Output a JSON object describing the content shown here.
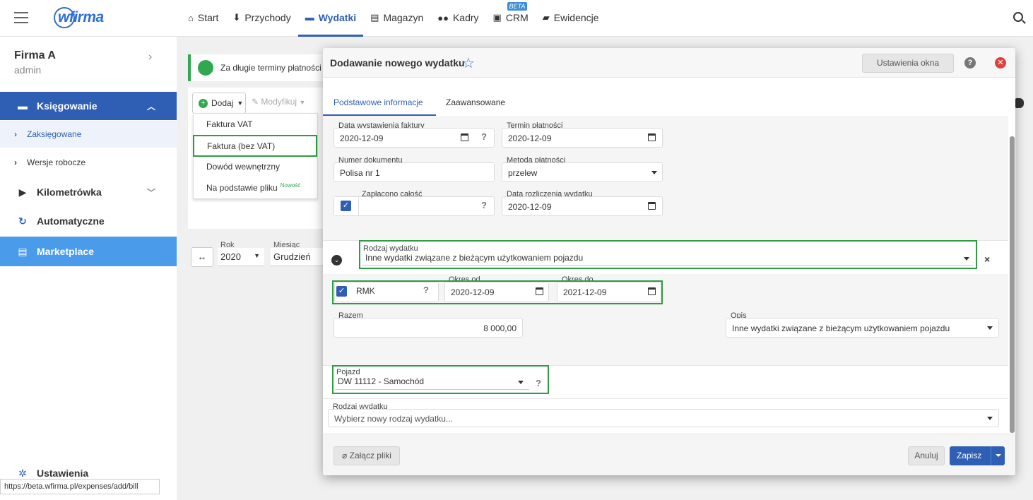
{
  "topnav": {
    "items": [
      {
        "label": "Start",
        "icon": "home-icon"
      },
      {
        "label": "Przychody",
        "icon": "income-icon"
      },
      {
        "label": "Wydatki",
        "icon": "wallet-icon"
      },
      {
        "label": "Magazyn",
        "icon": "warehouse-icon"
      },
      {
        "label": "Kadry",
        "icon": "people-icon"
      },
      {
        "label": "CRM",
        "icon": "crm-icon",
        "badge": "BETA"
      },
      {
        "label": "Ewidencje",
        "icon": "folder-icon"
      }
    ],
    "active": "Wydatki",
    "logo": "wfirma"
  },
  "sidebar": {
    "company_name": "Firma A",
    "user": "admin",
    "items": [
      {
        "label": "Księgowanie"
      },
      {
        "label": "Zaksięgowane"
      },
      {
        "label": "Wersje robocze"
      },
      {
        "label": "Kilometrówka"
      },
      {
        "label": "Automatyczne"
      },
      {
        "label": "Marketplace"
      },
      {
        "label": "Ustawienia"
      }
    ]
  },
  "statusbar": {
    "url": "https://beta.wfirma.pl/expenses/add/bill"
  },
  "background": {
    "banner_text": "Za długie terminy płatności",
    "dodaj_label": "Dodaj",
    "modyfikuj_label": "Modyfikuj",
    "dropdown_items": [
      {
        "label": "Faktura VAT"
      },
      {
        "label": "Faktura (bez VAT)"
      },
      {
        "label": "Dowód wewnętrzny"
      },
      {
        "label": "Na podstawie pliku",
        "badge": "Nowość"
      }
    ],
    "rok_label": "Rok",
    "rok_value": "2020",
    "miesiac_label": "Miesiąc",
    "miesiac_value": "Grudzień"
  },
  "modal": {
    "title": "Dodawanie nowego wydatku",
    "settings_button": "Ustawienia okna",
    "tabs": [
      {
        "label": "Podstawowe informacje"
      },
      {
        "label": "Zaawansowane"
      }
    ],
    "fields": {
      "data_wystawienia": {
        "label": "Data wystawienia faktury",
        "value": "2020-12-09"
      },
      "termin_platnosci": {
        "label": "Termin płatności",
        "value": "2020-12-09"
      },
      "numer_dokumentu": {
        "label": "Numer dokumentu",
        "value": "Polisa nr 1"
      },
      "metoda_platnosci": {
        "label": "Metoda płatności",
        "value": "przelew"
      },
      "zaplacono_calosc": {
        "label": "Zapłacono całość"
      },
      "data_rozliczenia": {
        "label": "Data rozliczenia wydatku",
        "value": "2020-12-09"
      },
      "rodzaj_wydatku": {
        "label": "Rodzaj wydatku",
        "value": "Inne wydatki związane z bieżącym użytkowaniem pojazdu"
      },
      "rmk": {
        "label": "RMK"
      },
      "okres_od": {
        "label": "Okres od",
        "value": "2020-12-09"
      },
      "okres_do": {
        "label": "Okres do",
        "value": "2021-12-09"
      },
      "razem": {
        "label": "Razem",
        "value": "8 000,00"
      },
      "opis": {
        "label": "Opis",
        "value": "Inne wydatki związane z bieżącym użytkowaniem pojazdu"
      },
      "pojazd": {
        "label": "Pojazd",
        "value": "DW 11112 - Samochód"
      },
      "rodzaj_wydatku_new": {
        "label": "Rodzaj wydatku",
        "placeholder": "Wybierz nowy rodzaj wydatku..."
      }
    },
    "footer": {
      "attach": "Załącz pliki",
      "cancel": "Anuluj",
      "save": "Zapisz"
    }
  },
  "colors": {
    "primary": "#2f5fb5",
    "highlight": "#2e9b45",
    "marketplace": "#4a9bea"
  }
}
